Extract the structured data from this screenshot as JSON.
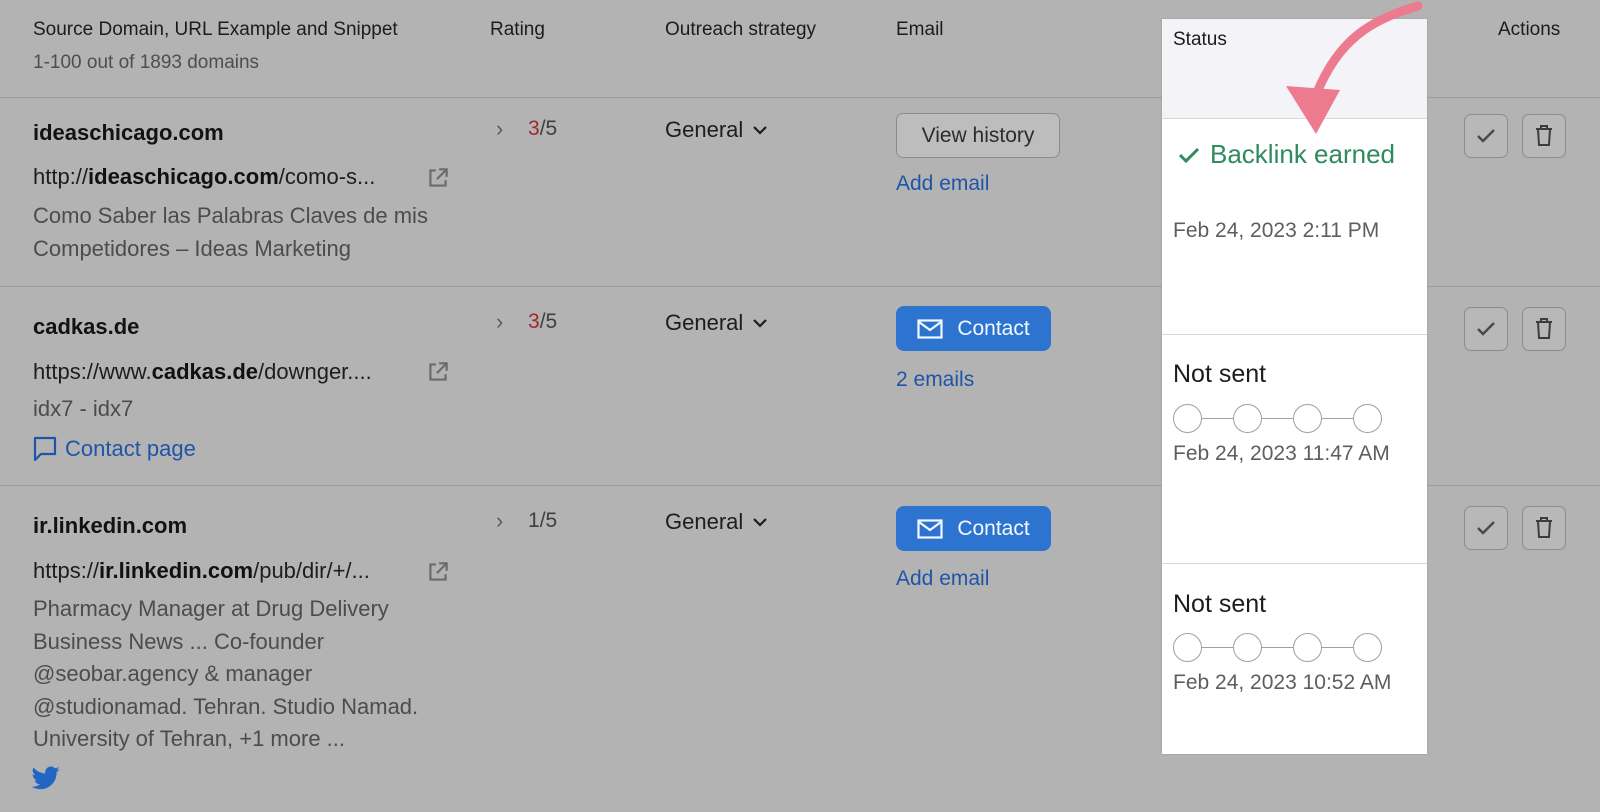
{
  "header": {
    "col_source": "Source Domain, URL Example and Snippet",
    "col_source_sub": "1-100 out of 1893 domains",
    "col_rating": "Rating",
    "col_strategy": "Outreach strategy",
    "col_email": "Email",
    "col_status": "Status",
    "col_actions": "Actions"
  },
  "rows": [
    {
      "domain": "ideaschicago.com",
      "url_prefix": "http://",
      "url_bold": "ideaschicago.com",
      "url_suffix": "/como-s...",
      "snippet": "Como Saber las Palabras Claves de mis Competidores – Ideas Marketing",
      "rating_value": "3",
      "rating_total": "/5",
      "strategy": "General",
      "email_button": "View history",
      "email_link": "Add email",
      "status": "Backlink earned",
      "status_date": "Feb 24, 2023 2:11 PM"
    },
    {
      "domain": "cadkas.de",
      "url_prefix": "https://www.",
      "url_bold": "cadkas.de",
      "url_suffix": "/downger....",
      "snippet": "idx7 - idx7",
      "contact_page": "Contact page",
      "rating_value": "3",
      "rating_total": "/5",
      "strategy": "General",
      "email_button": "Contact",
      "email_link": "2 emails",
      "status": "Not sent",
      "status_date": "Feb 24, 2023 11:47 AM"
    },
    {
      "domain": "ir.linkedin.com",
      "url_prefix": "https://",
      "url_bold": "ir.linkedin.com",
      "url_suffix": "/pub/dir/+/...",
      "snippet": "Pharmacy Manager at Drug Delivery Business News ... Co-founder @seobar.agency & manager @studionamad. Tehran. Studio Namad. University of Tehran, +1 more ...",
      "rating_value": "1",
      "rating_total": "/5",
      "strategy": "General",
      "email_button": "Contact",
      "email_link": "Add email",
      "status": "Not sent",
      "status_date": "Feb 24, 2023 10:52 AM"
    }
  ],
  "colors": {
    "background": "#b3b3b3",
    "accent_blue": "#2d74d0",
    "link_blue": "#1f55a8",
    "success_green": "#2f8a5c",
    "rating_red": "#a4272a",
    "arrow_pink": "#ec7b90",
    "status_panel": "#ffffff"
  },
  "icons": [
    "external-link-icon",
    "chevron-right-icon",
    "chevron-down-icon",
    "mail-icon",
    "chat-icon",
    "twitter-icon",
    "check-icon",
    "trash-icon",
    "arrow-icon"
  ]
}
